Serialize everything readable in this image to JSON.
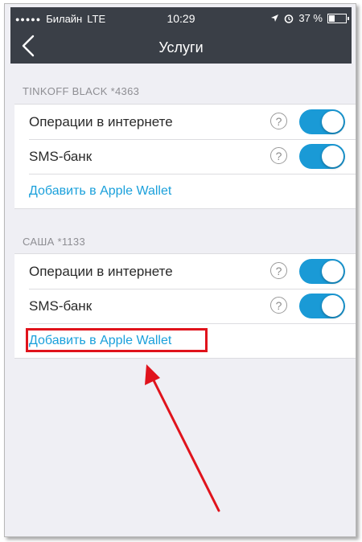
{
  "status_bar": {
    "signal": "●●●●●",
    "carrier": "Билайн",
    "network": "LTE",
    "time": "10:29",
    "battery_text": "37 %",
    "battery_level": 0.37
  },
  "nav": {
    "title": "Услуги"
  },
  "sections": [
    {
      "header": "TINKOFF BLACK *4363",
      "rows": [
        {
          "label": "Операции в интернете",
          "help": "?",
          "enabled": true
        },
        {
          "label": "SMS-банк",
          "help": "?",
          "enabled": true
        }
      ],
      "link": "Добавить в Apple Wallet"
    },
    {
      "header": "САША *1133",
      "rows": [
        {
          "label": "Операции в интернете",
          "help": "?",
          "enabled": true
        },
        {
          "label": "SMS-банк",
          "help": "?",
          "enabled": true
        }
      ],
      "link": "Добавить в Apple Wallet"
    }
  ],
  "colors": {
    "accent": "#1a9ad6",
    "link": "#1aa0db",
    "header_bar": "#3a3f47",
    "annotation": "#e0131c"
  }
}
